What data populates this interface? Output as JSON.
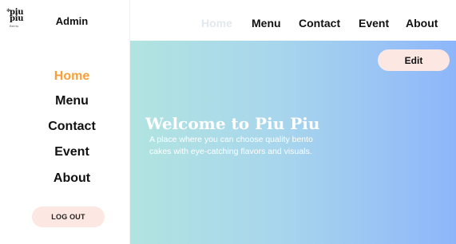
{
  "sidebar": {
    "logo": {
      "line1": "piu",
      "line2": "piu",
      "tagline": "Bento",
      "mark": "✻"
    },
    "admin_label": "Admin",
    "items": [
      {
        "label": "Home",
        "active": true
      },
      {
        "label": "Menu",
        "active": false
      },
      {
        "label": "Contact",
        "active": false
      },
      {
        "label": "Event",
        "active": false
      },
      {
        "label": "About",
        "active": false
      }
    ],
    "logout_label": "LOG OUT"
  },
  "topbar": {
    "items": [
      {
        "label": "Home"
      },
      {
        "label": "Menu"
      },
      {
        "label": "Contact"
      },
      {
        "label": "Event"
      },
      {
        "label": "About"
      }
    ]
  },
  "hero": {
    "edit_label": "Edit",
    "title": "Welcome to Piu Piu",
    "description": "A place where you can choose quality bento cakes with eye-catching flavors and visuals."
  },
  "colors": {
    "active_nav": "#f5a03a",
    "button_bg": "#fde7e2",
    "hero_gradient_start": "#b1e4e0",
    "hero_gradient_end": "#8db6fa"
  }
}
